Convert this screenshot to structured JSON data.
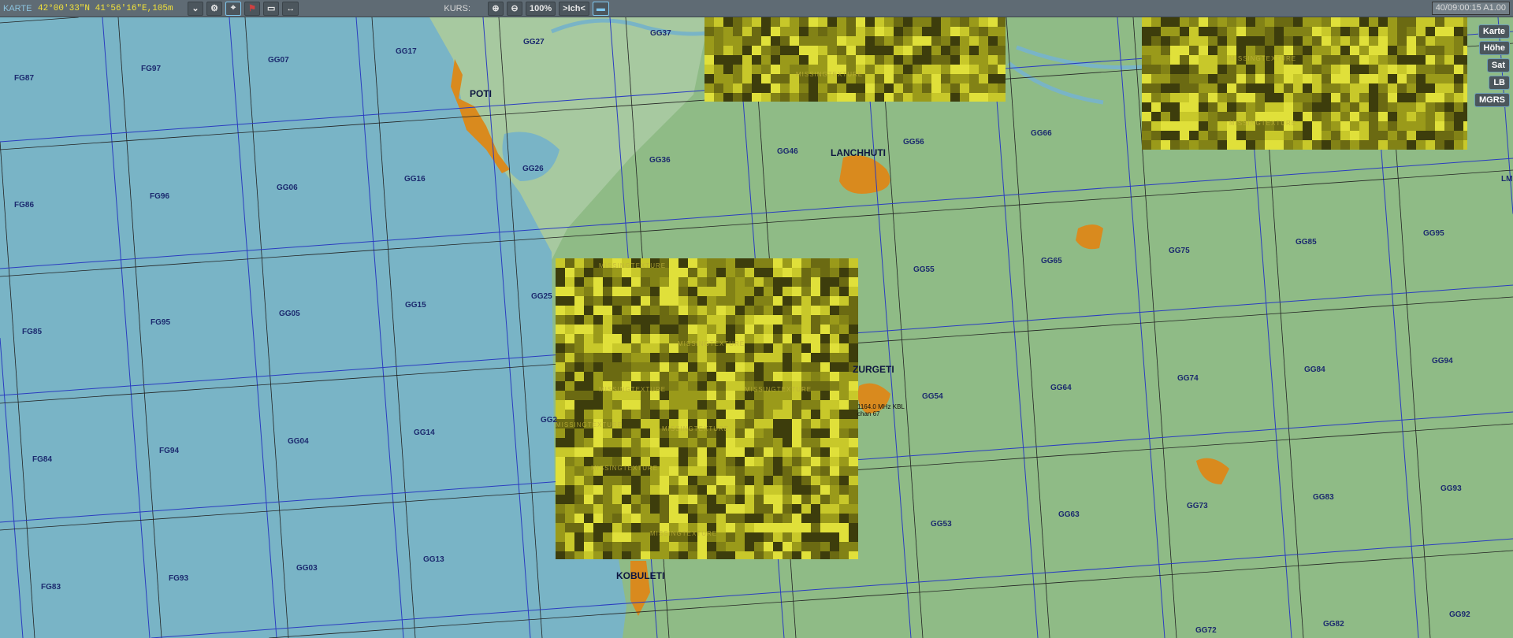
{
  "toolbar": {
    "mode": "KARTE",
    "coords": "42°00'33\"N 41°56'16\"E,105m",
    "kurs_label": "KURS:",
    "zoom": "100%",
    "center_label": ">Ich<",
    "clock": "40/09:00:15 A1.00",
    "icons": [
      "route-icon",
      "waypoint-icon",
      "radar-icon",
      "target-icon",
      "marker-icon",
      "measure-icon"
    ]
  },
  "side_buttons": [
    "Karte",
    "Höhe",
    "Sat",
    "LB",
    "MGRS"
  ],
  "grid_labels": [
    "FG87",
    "FG97",
    "GG07",
    "GG17",
    "GG27",
    "GG37",
    "FG86",
    "FG96",
    "GG06",
    "GG16",
    "GG26",
    "GG36",
    "GG46",
    "GG56",
    "GG66",
    "FG85",
    "FG95",
    "GG05",
    "GG15",
    "GG25",
    "GG55",
    "GG65",
    "GG75",
    "GG85",
    "GG95",
    "FG84",
    "FG94",
    "GG04",
    "GG14",
    "GG54",
    "GG64",
    "GG74",
    "GG84",
    "GG94",
    "FG83",
    "FG93",
    "GG03",
    "GG13",
    "GG53",
    "GG63",
    "GG73",
    "GG83",
    "GG93",
    "GG72",
    "GG82",
    "GG92",
    "GG2",
    "LM"
  ],
  "cities": [
    "POTI",
    "LANCHHUTI",
    "ZURGETI",
    "KOBULETI"
  ],
  "navaid": {
    "freq": "1164.0 MHz KBL",
    "chan": "chan 67"
  },
  "missing_texture": "MISSINGTEXTURE",
  "colors": {
    "sea": "#79b4c6",
    "land": "#8fbb86",
    "coast": "#a7c9a0",
    "city": "#d98a1e",
    "grid_blue": "#2a3cc0"
  }
}
